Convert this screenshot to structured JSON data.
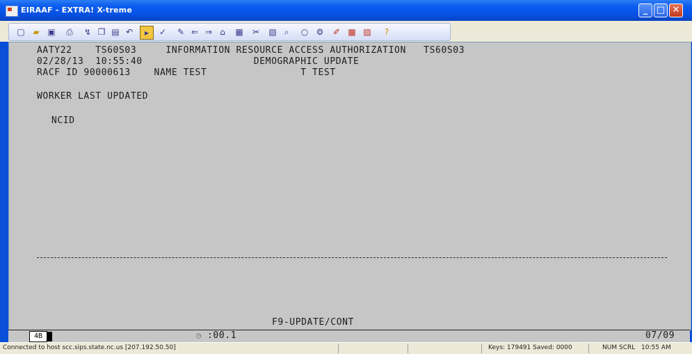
{
  "window": {
    "title": "EIRAAF - EXTRA! X-treme"
  },
  "toolbar": {
    "icons": [
      "new-session-icon",
      "open-icon",
      "save-icon",
      "print-icon",
      "transfer-icon",
      "copy-icon",
      "paste-icon",
      "undo-icon",
      "macro-icon",
      "run-macro-icon",
      "edit-icon",
      "back-icon",
      "forward-icon",
      "home-icon",
      "quickpad-icon",
      "tools-icon",
      "clipboard-icon",
      "find-icon",
      "circle-icon",
      "settings-icon",
      "edit-hotspot-icon",
      "grid-icon",
      "chart-icon",
      "help-icon"
    ]
  },
  "terminal": {
    "line1": "AATY22    TS60S03     INFORMATION RESOURCE ACCESS AUTHORIZATION   TS60S03",
    "line2": "02/28/13  10:55:40                   DEMOGRAPHIC UPDATE",
    "line3": "RACF ID 90000613    NAME TEST                T TEST",
    "worker_label": "WORKER LAST UPDATED",
    "ncid_label": "NCID",
    "ncid_value": "",
    "function_key": "F9-UPDATE/CONT"
  },
  "oia": {
    "block_label": "4B",
    "timer": ":00.1",
    "cursor_pos": "07/09"
  },
  "statusbar": {
    "connection": "Connected to host scc.sips.state.nc.us [207.192.50.50]",
    "keys": "Keys: 179491 Saved: 0000",
    "num": "NUM",
    "scrl": "SCRL",
    "time": "10:55 AM"
  }
}
